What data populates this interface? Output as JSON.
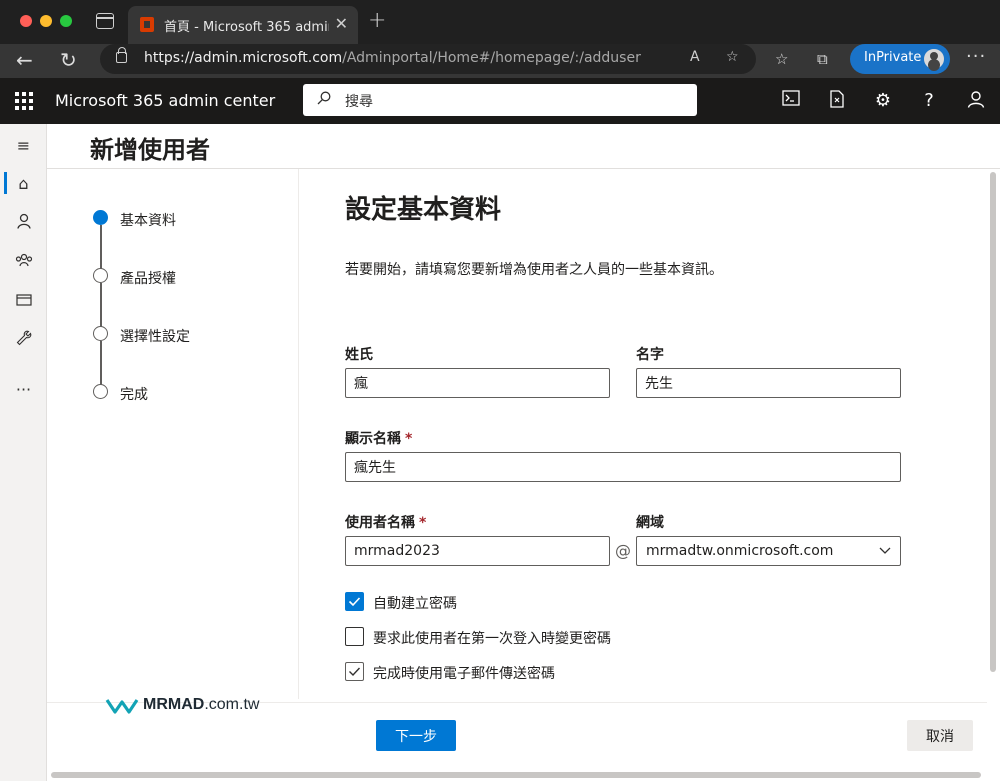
{
  "browser": {
    "tab_title": "首頁 - Microsoft 365 admin center",
    "url_host": "https://admin.microsoft.com",
    "url_path": "/Adminportal/Home#/homepage/:/adduser",
    "inprivate_label": "InPrivate"
  },
  "header": {
    "app_name": "Microsoft 365 admin center",
    "search_placeholder": "搜尋"
  },
  "page": {
    "title": "新增使用者"
  },
  "steps": [
    {
      "label": "基本資料",
      "active": true
    },
    {
      "label": "產品授權",
      "active": false
    },
    {
      "label": "選擇性設定",
      "active": false
    },
    {
      "label": "完成",
      "active": false
    }
  ],
  "form": {
    "section_title": "設定基本資料",
    "intro": "若要開始，請填寫您要新增為使用者之人員的一些基本資訊。",
    "last_name_label": "姓氏",
    "last_name_value": "瘋",
    "first_name_label": "名字",
    "first_name_value": "先生",
    "display_name_label": "顯示名稱",
    "display_name_value": "瘋先生",
    "username_label": "使用者名稱",
    "username_value": "mrmad2023",
    "at_sign": "@",
    "domain_label": "網域",
    "domain_value": "mrmadtw.onmicrosoft.com",
    "required_marker": "*",
    "checkboxes": [
      {
        "label": "自動建立密碼",
        "checked": true
      },
      {
        "label": "要求此使用者在第一次登入時變更密碼",
        "checked": false
      },
      {
        "label": "完成時使用電子郵件傳送密碼",
        "checked": true
      }
    ]
  },
  "footer": {
    "next_label": "下一步",
    "cancel_label": "取消"
  },
  "watermark": {
    "brand": "MRMAD",
    "suffix": ".com.tw"
  },
  "colors": {
    "accent": "#0078d4",
    "header_bg": "#1b1a19",
    "required": "#a4262c"
  }
}
